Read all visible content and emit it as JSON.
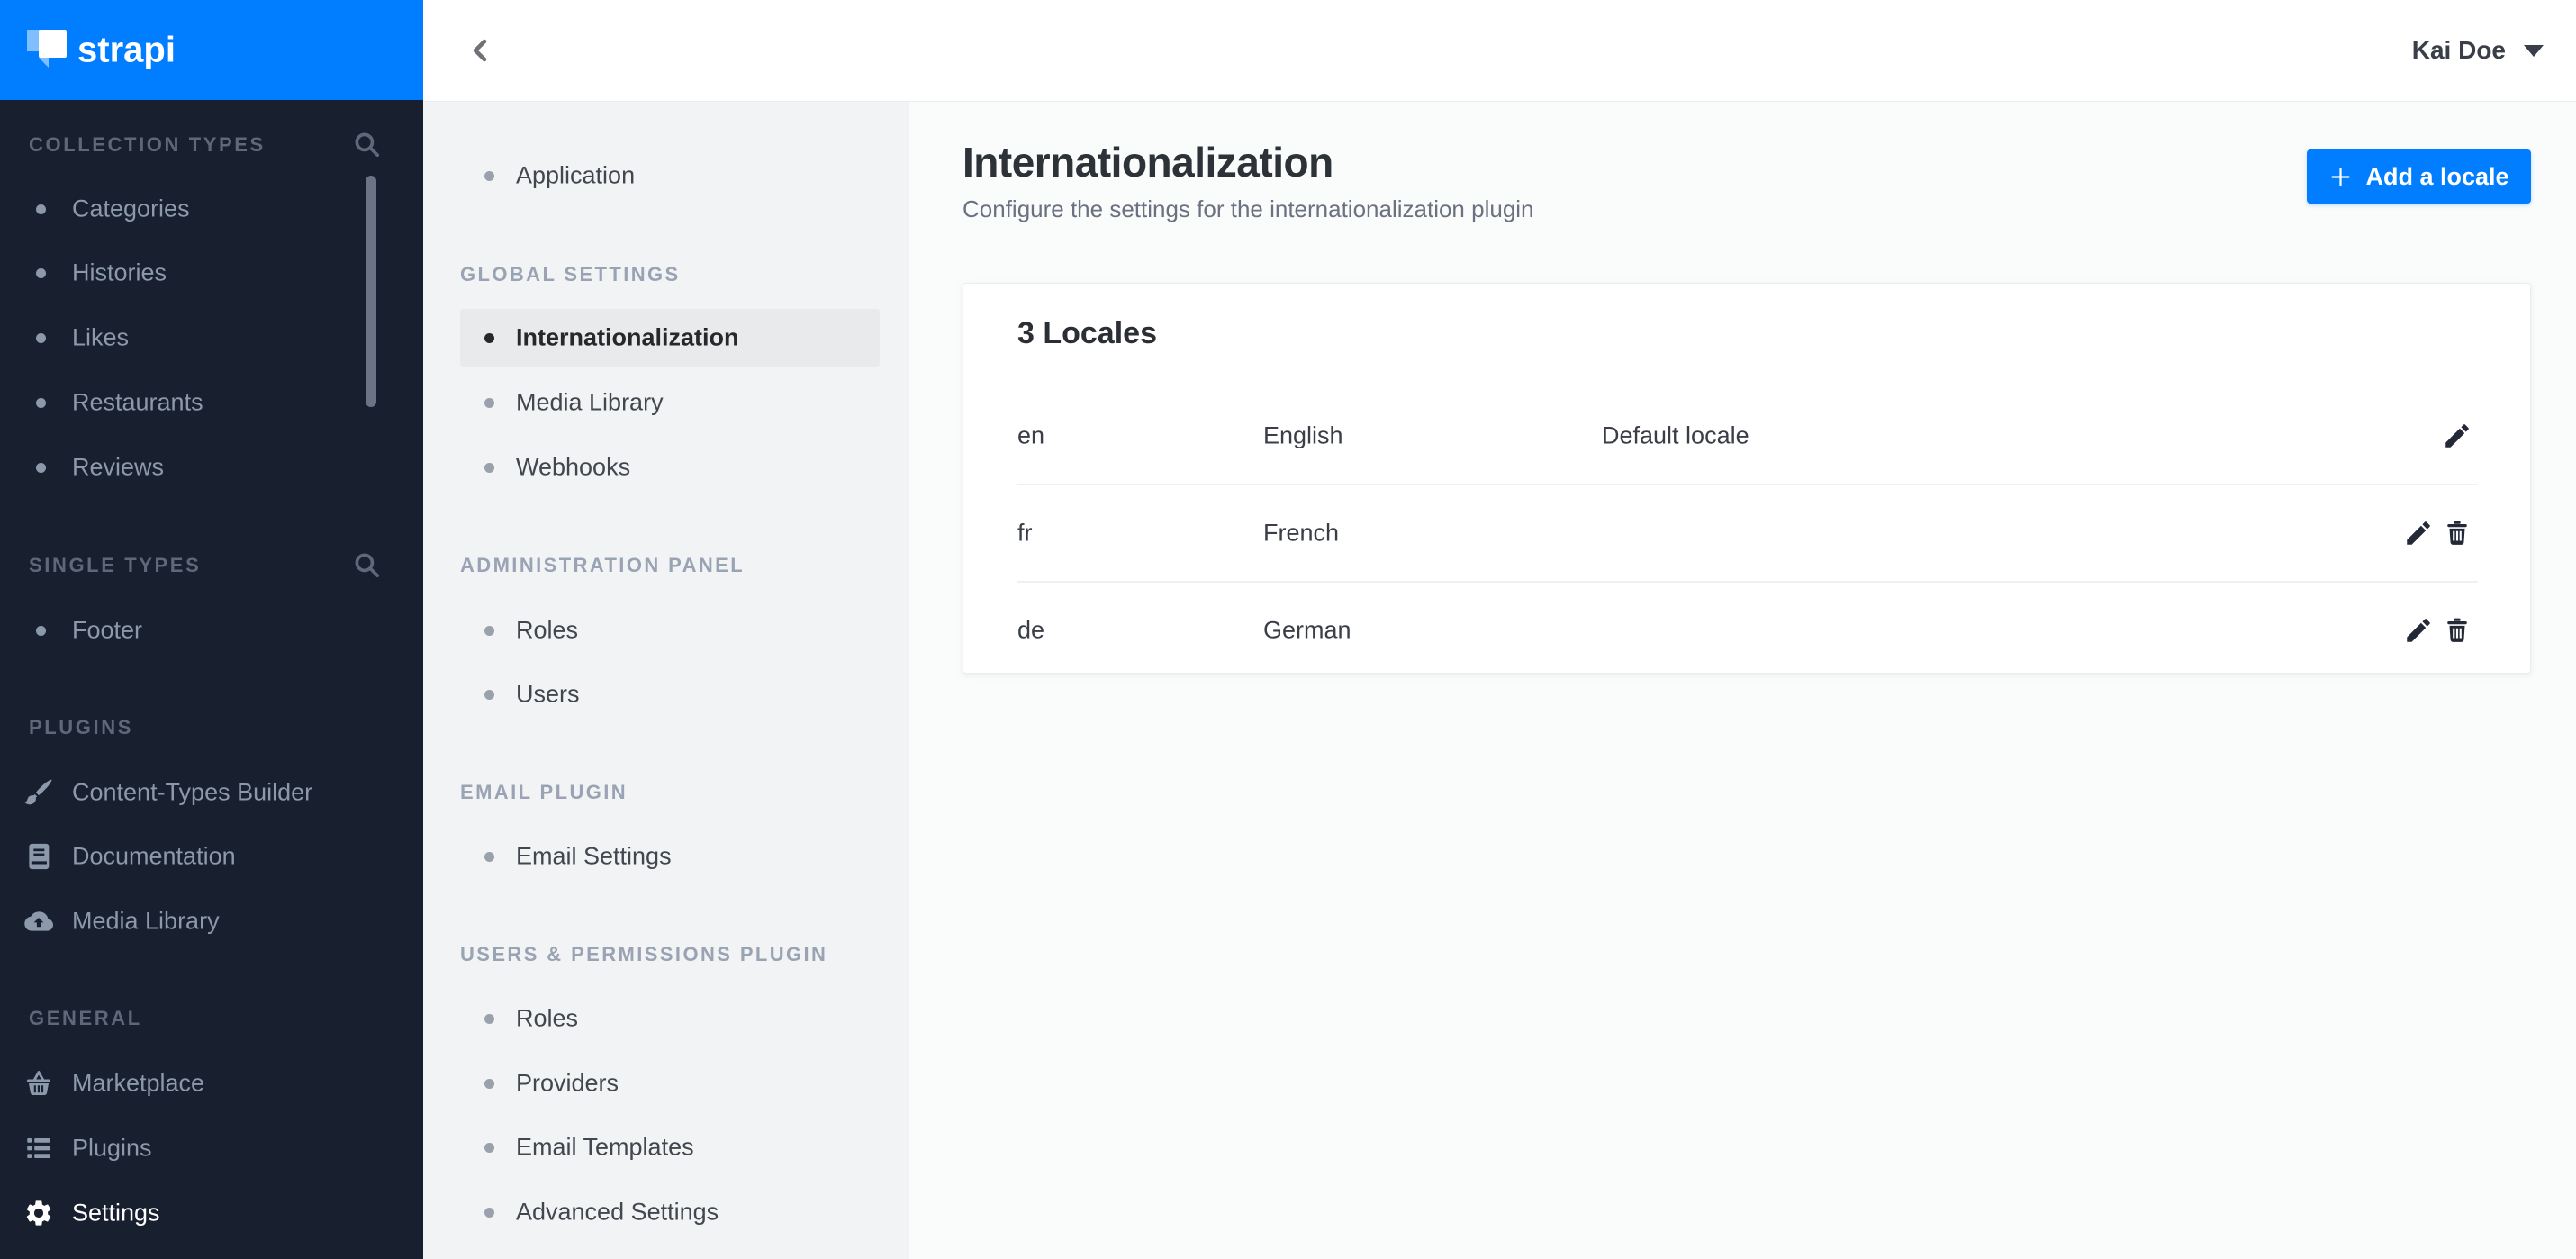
{
  "colors": {
    "brand_blue": "#007EFF",
    "sidebar_bg": "#181F2E",
    "sidebar_text": "#8C99AB",
    "sidebar_header": "#5E6878",
    "panel_bg": "#F2F3F4",
    "panel_active_bg": "#E9EAEB",
    "panel_text": "#42474F",
    "panel_header": "#9AA3B4",
    "main_bg": "#FAFBFB",
    "text_dark": "#2D3138",
    "icon_dark": "#242938"
  },
  "brand": {
    "wordmark": "strapi",
    "logo_icon": "strapi-logo-icon"
  },
  "sidebar": {
    "sections": [
      {
        "label": "COLLECTION TYPES",
        "search_icon": "search-icon",
        "items": [
          {
            "label": "Categories"
          },
          {
            "label": "Histories"
          },
          {
            "label": "Likes"
          },
          {
            "label": "Restaurants"
          },
          {
            "label": "Reviews"
          }
        ]
      },
      {
        "label": "SINGLE TYPES",
        "search_icon": "search-icon",
        "items": [
          {
            "label": "Footer"
          }
        ]
      },
      {
        "label": "PLUGINS",
        "items": [
          {
            "label": "Content-Types Builder",
            "icon": "paintbrush-icon"
          },
          {
            "label": "Documentation",
            "icon": "book-icon"
          },
          {
            "label": "Media Library",
            "icon": "cloud-upload-icon"
          }
        ]
      },
      {
        "label": "GENERAL",
        "items": [
          {
            "label": "Marketplace",
            "icon": "basket-icon"
          },
          {
            "label": "Plugins",
            "icon": "list-icon"
          },
          {
            "label": "Settings",
            "icon": "gear-icon",
            "active": true
          }
        ]
      }
    ]
  },
  "topbar": {
    "back_icon": "chevron-left-icon",
    "user_name": "Kai Doe",
    "user_caret_icon": "caret-down-icon"
  },
  "settings_nav": {
    "groups": [
      {
        "header": "",
        "items": [
          {
            "label": "Application"
          }
        ]
      },
      {
        "header": "GLOBAL SETTINGS",
        "items": [
          {
            "label": "Internationalization",
            "active": true
          },
          {
            "label": "Media Library"
          },
          {
            "label": "Webhooks"
          }
        ]
      },
      {
        "header": "ADMINISTRATION PANEL",
        "items": [
          {
            "label": "Roles"
          },
          {
            "label": "Users"
          }
        ]
      },
      {
        "header": "EMAIL PLUGIN",
        "items": [
          {
            "label": "Email Settings"
          }
        ]
      },
      {
        "header": "USERS & PERMISSIONS PLUGIN",
        "items": [
          {
            "label": "Roles"
          },
          {
            "label": "Providers"
          },
          {
            "label": "Email Templates"
          },
          {
            "label": "Advanced Settings"
          }
        ]
      }
    ]
  },
  "main": {
    "title": "Internationalization",
    "subtitle": "Configure the settings for the internationalization plugin",
    "add_button": {
      "label": "Add a locale",
      "icon": "plus-icon"
    },
    "card": {
      "title": "3 Locales",
      "rows": [
        {
          "code": "en",
          "name": "English",
          "badge": "Default locale",
          "actions": [
            "edit"
          ]
        },
        {
          "code": "fr",
          "name": "French",
          "badge": "",
          "actions": [
            "edit",
            "delete"
          ]
        },
        {
          "code": "de",
          "name": "German",
          "badge": "",
          "actions": [
            "edit",
            "delete"
          ]
        }
      ]
    }
  }
}
